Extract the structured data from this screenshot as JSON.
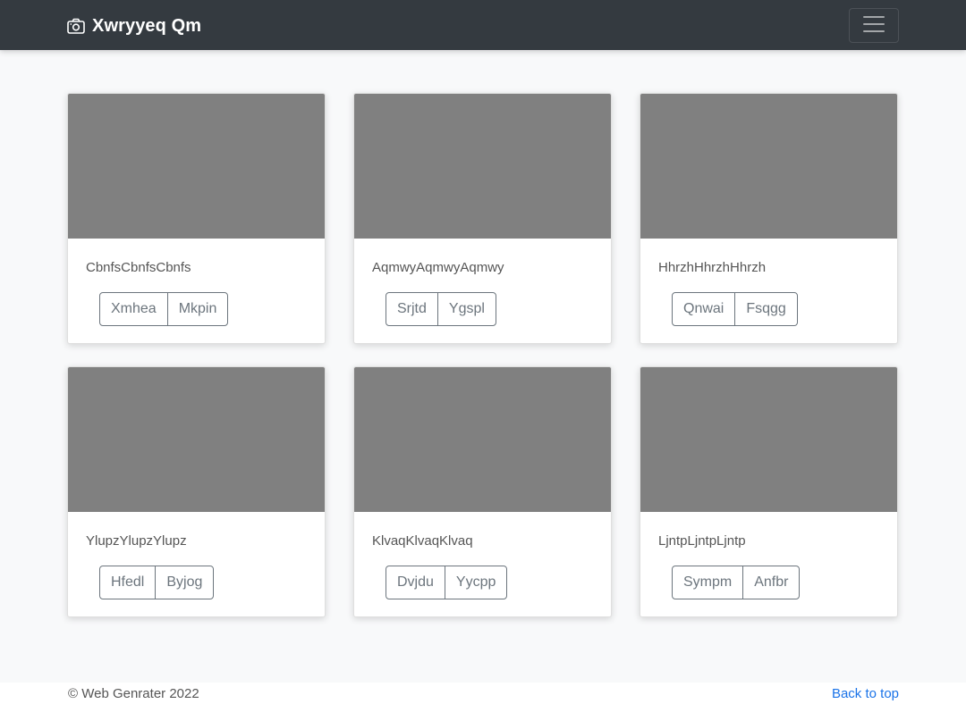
{
  "navbar": {
    "brand": "Xwryyeq Qm",
    "brand_icon": "camera-icon",
    "toggler_icon": "hamburger-menu-icon"
  },
  "cards": [
    {
      "title": "CbnfsCbnfsCbnfs",
      "buttons": [
        "Xmhea",
        "Mkpin"
      ]
    },
    {
      "title": "AqmwyAqmwyAqmwy",
      "buttons": [
        "Srjtd",
        "Ygspl"
      ]
    },
    {
      "title": "HhrzhHhrzhHhrzh",
      "buttons": [
        "Qnwai",
        "Fsqgg"
      ]
    },
    {
      "title": "YlupzYlupzYlupz",
      "buttons": [
        "Hfedl",
        "Byjog"
      ]
    },
    {
      "title": "KlvaqKlvaqKlvaq",
      "buttons": [
        "Dvjdu",
        "Yycpp"
      ]
    },
    {
      "title": "LjntpLjntpLjntp",
      "buttons": [
        "Sympm",
        "Anfbr"
      ]
    }
  ],
  "footer": {
    "copyright": "© Web Genrater 2022",
    "back_to_top": "Back to top"
  },
  "colors": {
    "navbar_bg": "#343a40",
    "page_bg": "#f8f9fa",
    "thumbnail": "#808080",
    "button_border": "#6c757d",
    "link": "#1a73e8"
  }
}
